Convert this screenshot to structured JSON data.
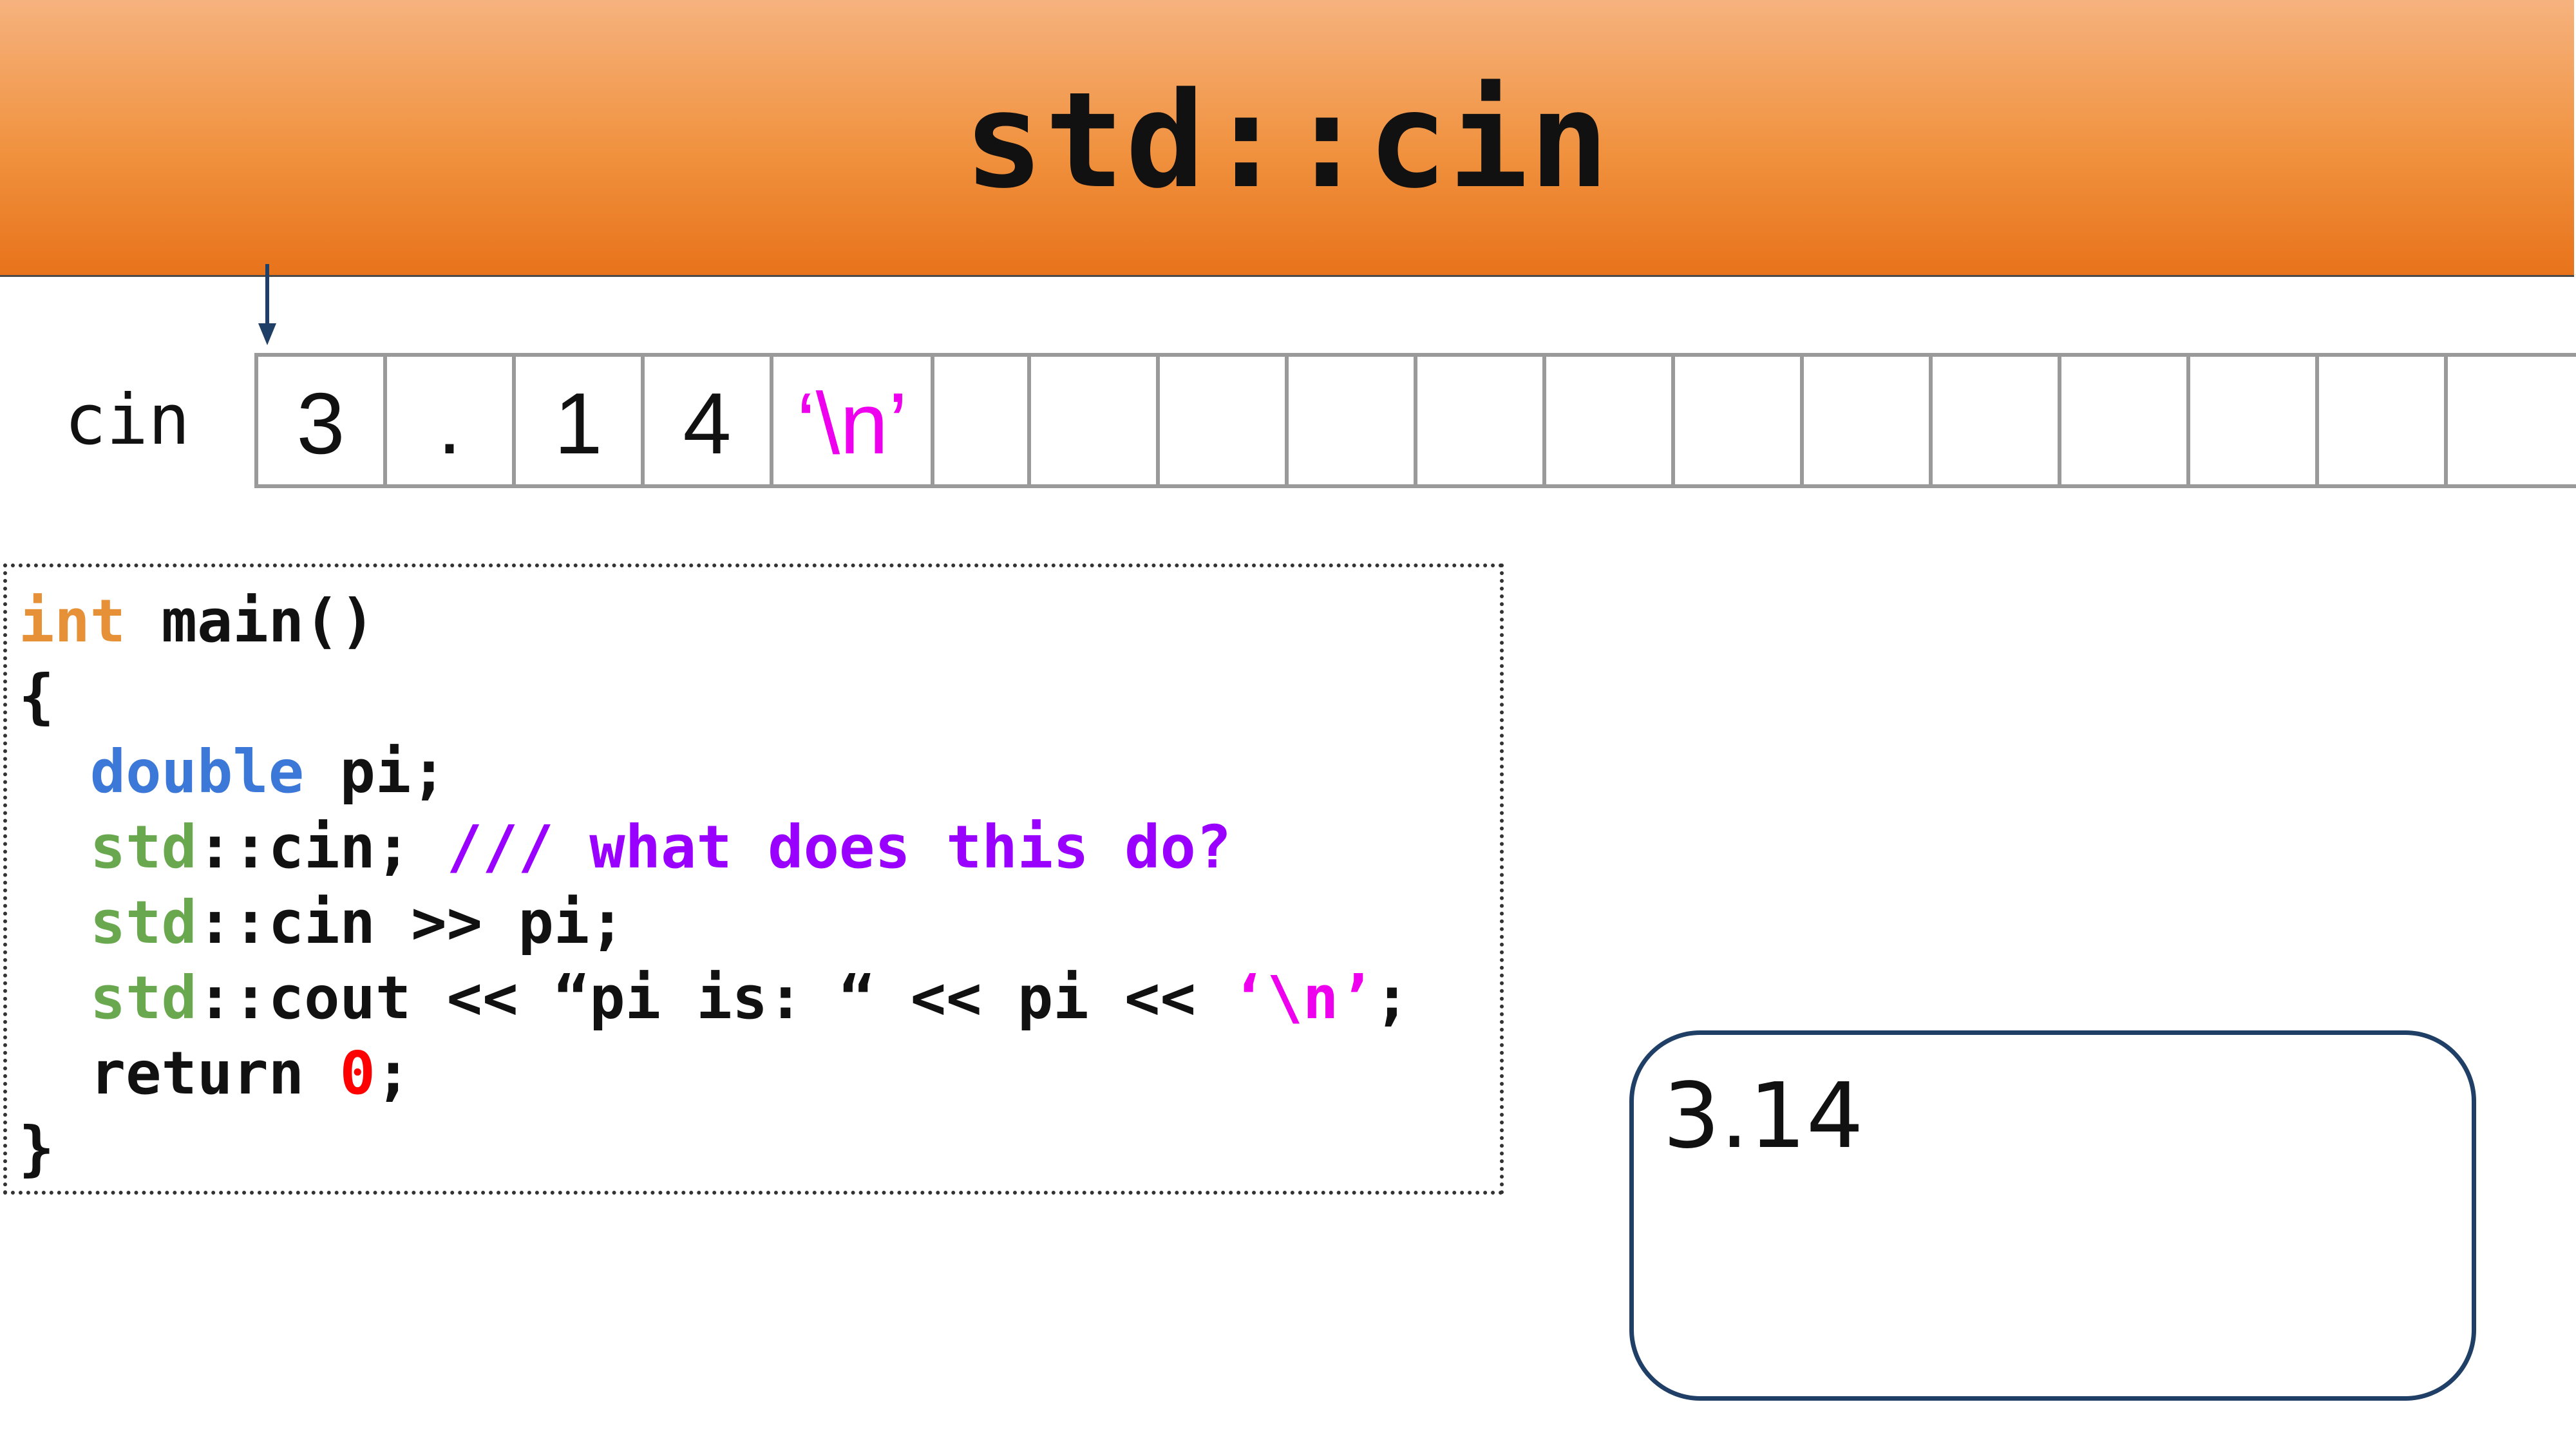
{
  "title": "std::cin",
  "stream": {
    "label": "cin",
    "cells": [
      "3",
      ".",
      "1",
      "4",
      "‘\\n’",
      "",
      "",
      "",
      "",
      "",
      "",
      "",
      "",
      "",
      "",
      "",
      "",
      ""
    ],
    "pointer_index": 0
  },
  "code": {
    "line1": {
      "type": "int",
      "rest": " main()"
    },
    "line2": "{",
    "line3": {
      "indent": "  ",
      "type": "double",
      "rest": " pi;"
    },
    "line4": {
      "indent": "  ",
      "ns": "std",
      "rest": "::cin; ",
      "comment": "/// what does this do?"
    },
    "line5": {
      "indent": "  ",
      "ns": "std",
      "rest": "::cin >> pi;"
    },
    "line6": {
      "indent": "  ",
      "ns": "std",
      "rest": "::cout << “pi is: “ << pi << ",
      "char": "‘\\n’",
      "end": ";"
    },
    "line7": {
      "indent": "  ",
      "keyword": "return ",
      "num": "0",
      "end": ";"
    },
    "line8": "}"
  },
  "output": {
    "text": "3.14"
  },
  "colors": {
    "banner": "#f0923f",
    "type_keyword": "#e69138",
    "double_keyword": "#3c78d8",
    "namespace": "#6aa84f",
    "comment": "#9900ff",
    "char_literal": "#ee00ee",
    "number_literal": "#ff0000",
    "output_border": "#1f3f66",
    "arrow": "#1f3f66"
  }
}
